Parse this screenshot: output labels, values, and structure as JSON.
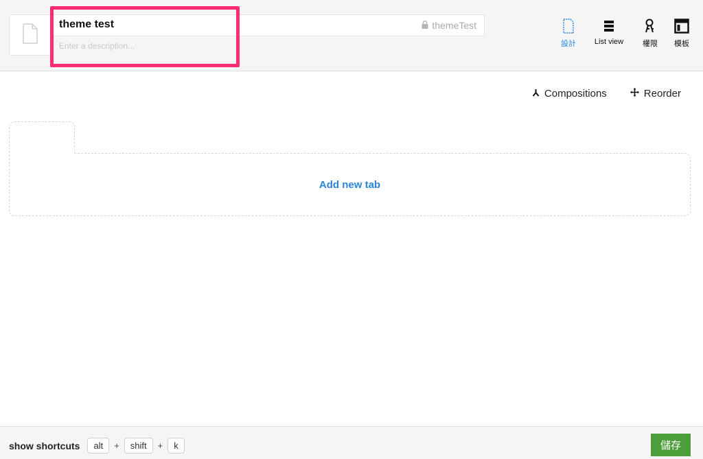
{
  "header": {
    "title": "theme test",
    "description_placeholder": "Enter a description...",
    "identifier": "themeTest",
    "tools": [
      {
        "label": "設計",
        "icon": "document-icon",
        "active": true
      },
      {
        "label": "List view",
        "icon": "list-icon",
        "active": false
      },
      {
        "label": "權限",
        "icon": "keys-icon",
        "active": false
      },
      {
        "label": "模板",
        "icon": "template-icon",
        "active": false
      }
    ]
  },
  "actions": {
    "compositions": "Compositions",
    "reorder": "Reorder"
  },
  "tabs": {
    "add_new_tab": "Add new tab"
  },
  "footer": {
    "shortcuts_label": "show shortcuts",
    "keys": [
      "alt",
      "shift",
      "k"
    ],
    "separator": "+",
    "save_label": "儲存"
  },
  "colors": {
    "accent": "#2a84d8",
    "highlight": "#ff2d6f",
    "save": "#4c9e3b"
  }
}
